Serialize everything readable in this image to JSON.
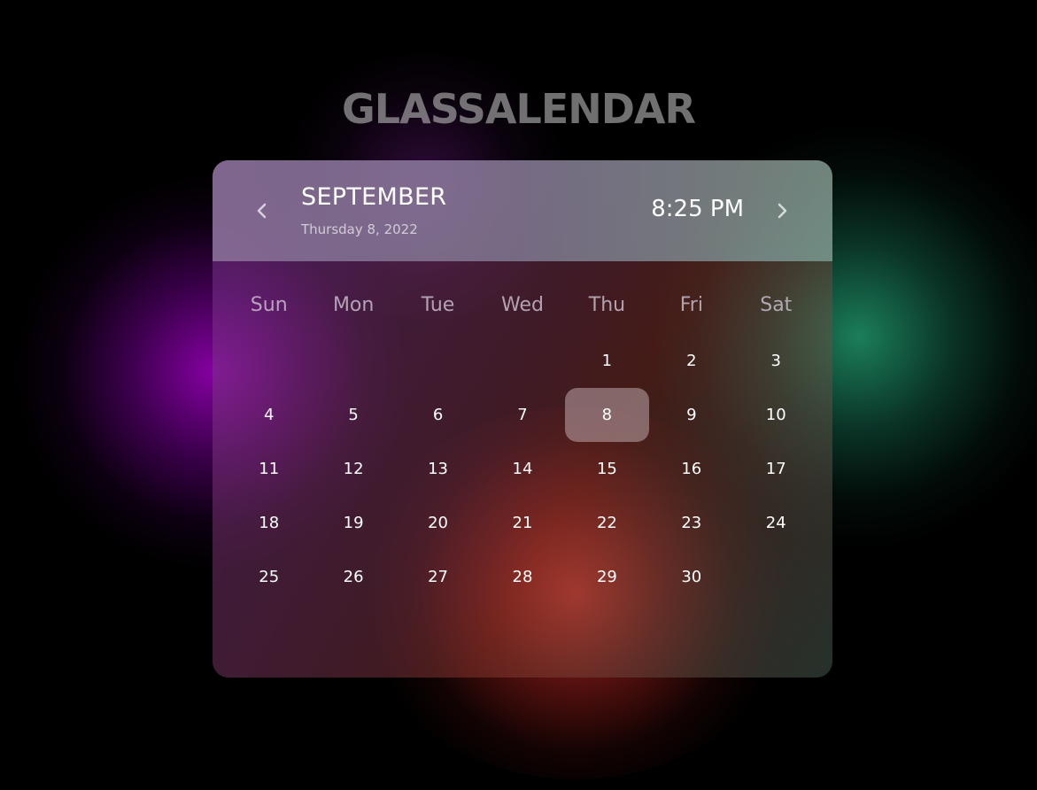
{
  "app": {
    "title": "GLASSALENDAR"
  },
  "header": {
    "prev_icon": "chevron-left-icon",
    "next_icon": "chevron-right-icon",
    "month": "SEPTEMBER",
    "full_date": "Thursday 8, 2022",
    "time": "8:25 PM"
  },
  "weekdays": [
    "Sun",
    "Mon",
    "Tue",
    "Wed",
    "Thu",
    "Fri",
    "Sat"
  ],
  "days": [
    "",
    "",
    "",
    "",
    "1",
    "2",
    "3",
    "4",
    "5",
    "6",
    "7",
    "8",
    "9",
    "10",
    "11",
    "12",
    "13",
    "14",
    "15",
    "16",
    "17",
    "18",
    "19",
    "20",
    "21",
    "22",
    "23",
    "24",
    "25",
    "26",
    "27",
    "28",
    "29",
    "30",
    ""
  ],
  "selected_day": "8",
  "colors": {
    "background": "#000000",
    "glow_purple": "#8c00aa",
    "glow_green": "#1e8c64",
    "glow_red": "#be3228",
    "text_primary": "#ffffff"
  }
}
